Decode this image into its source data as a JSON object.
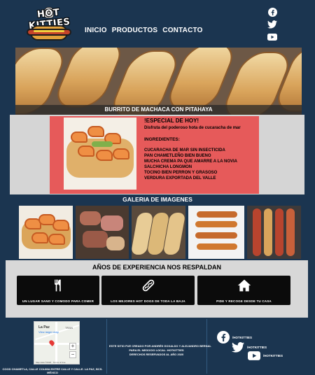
{
  "brand": {
    "logo_text": "HOT KITTIES",
    "logo_icon": "hot-dog-cat-logo"
  },
  "nav": {
    "items": [
      "INICIO",
      "PRODUCTOS",
      "CONTACTO"
    ]
  },
  "social_top": [
    "facebook-icon",
    "twitter-icon",
    "youtube-icon"
  ],
  "hero": {
    "caption": "BURRITO DE MACHACA CON PITAHAYA"
  },
  "special": {
    "title": "!ESPECIAL DE HOY!",
    "description": "Disfruta del poderoso hota de cucaracha de mar",
    "ingredients_heading": "INGREDIENTES:",
    "ingredients": [
      "CUCARACHA DE MAR SIN INSECTICIDA",
      "PAN CHAMETLEÑO BIEN BUENO",
      "MUCHA CREMA PA QUE AMARRE A LA NOVIA",
      "SALCHICHA LONGMON",
      "TOCINO BIEN PERRON Y GRASOSO",
      "VERDURA EXPORTADA DEL VALLE"
    ]
  },
  "gallery": {
    "title": "GALERIA DE IMAGENES",
    "items": [
      "shrimp-hotdog-photo",
      "sliced-meat-photo",
      "burritos-photo",
      "hotdog-skewers-photo",
      "bacon-hotdogs-photo"
    ]
  },
  "experience": {
    "title": "AÑOS DE EXPERIENCIA NOS RESPALDAN",
    "cards": [
      {
        "icon": "utensils-icon",
        "label": "UN LUGAR SANO Y COMODO PARA COMER"
      },
      {
        "icon": "hotdog-icon",
        "label": "LOS MEJORES HOT DOGS DE TODA LA BAJA"
      },
      {
        "icon": "home-icon",
        "label": "PIDE Y RECOGE DESDE TU CASA"
      }
    ]
  },
  "footer": {
    "map": {
      "place": "La Paz",
      "link": "View larger map",
      "road_label": "TRAN",
      "attribution": "Map data ©2020 · Terms of Use"
    },
    "address": "COOD CHAMETLA, CALLE COLIMA ENTRE CALLE Y CALLE. LA PAZ, BCS. MÉXICO",
    "credits": [
      "ESTE SITIO FUE CREADO POR ANDRÉS GOXALDO Y ALEJANDRO BERNAL",
      "PARA EL NEGOCIO LOCAL: HOTKITTIES",
      "DERECHOS RESERVADOS AL AÑO 2020"
    ],
    "social": [
      {
        "icon": "facebook-icon",
        "label": "/HOTKITTIES"
      },
      {
        "icon": "twitter-icon",
        "label": "/HOTKITTIES"
      },
      {
        "icon": "youtube-icon",
        "label": "/HOTKITTIES"
      }
    ]
  },
  "colors": {
    "background": "#1b3550",
    "special_panel": "#e65a5a",
    "panel_gray": "#d5d5d5",
    "card_black": "#0b0b0b"
  }
}
